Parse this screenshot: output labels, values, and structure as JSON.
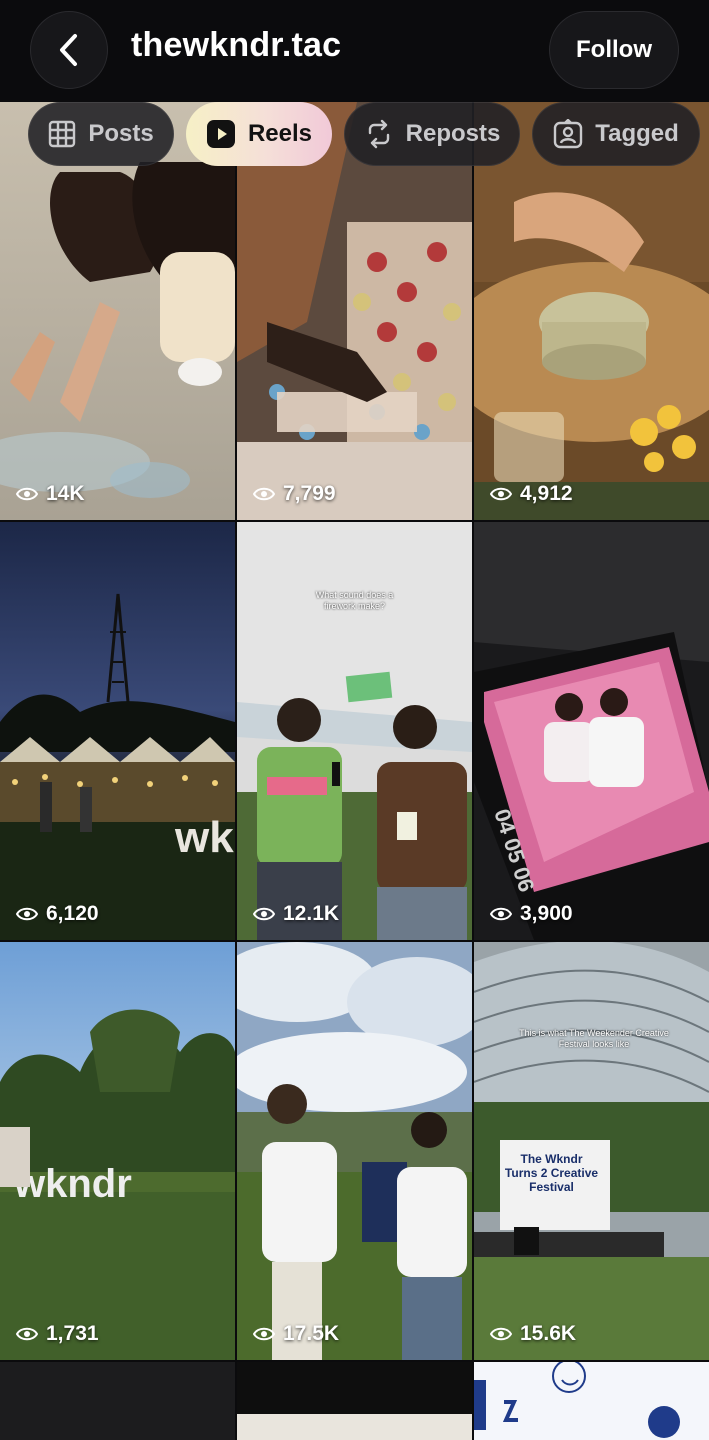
{
  "header": {
    "title": "thewkndr.tac",
    "follow_label": "Follow"
  },
  "tabs": [
    {
      "label": "Posts",
      "icon": "grid-icon",
      "active": false
    },
    {
      "label": "Reels",
      "icon": "reels-icon",
      "active": true
    },
    {
      "label": "Reposts",
      "icon": "repost-icon",
      "active": false
    },
    {
      "label": "Tagged",
      "icon": "tagged-icon",
      "active": false
    }
  ],
  "reels": [
    {
      "views": "14K",
      "scene": "people drawing with chalk on pavement"
    },
    {
      "views": "7,799",
      "scene": "hands picking bracelets from bead trays"
    },
    {
      "views": "4,912",
      "scene": "matcha whisking in bowl"
    },
    {
      "views": "6,120",
      "scene": "night market stalls with wk letters"
    },
    {
      "views": "12.1K",
      "scene": "interview at outdoor festival",
      "caption": "What sound does a firework make?"
    },
    {
      "views": "3,900",
      "scene": "couple photo in photobooth frame"
    },
    {
      "views": "1,731",
      "scene": "wkndr sign on grassy lawn",
      "sign": "wkndr"
    },
    {
      "views": "17.5K",
      "scene": "two girls with microphone at festival"
    },
    {
      "views": "15.6K",
      "scene": "stage under clear tent",
      "caption": "This is what The Weekender Creative Festival looks like",
      "banner": "The Wkndr Turns 2 Creative Festival"
    }
  ]
}
